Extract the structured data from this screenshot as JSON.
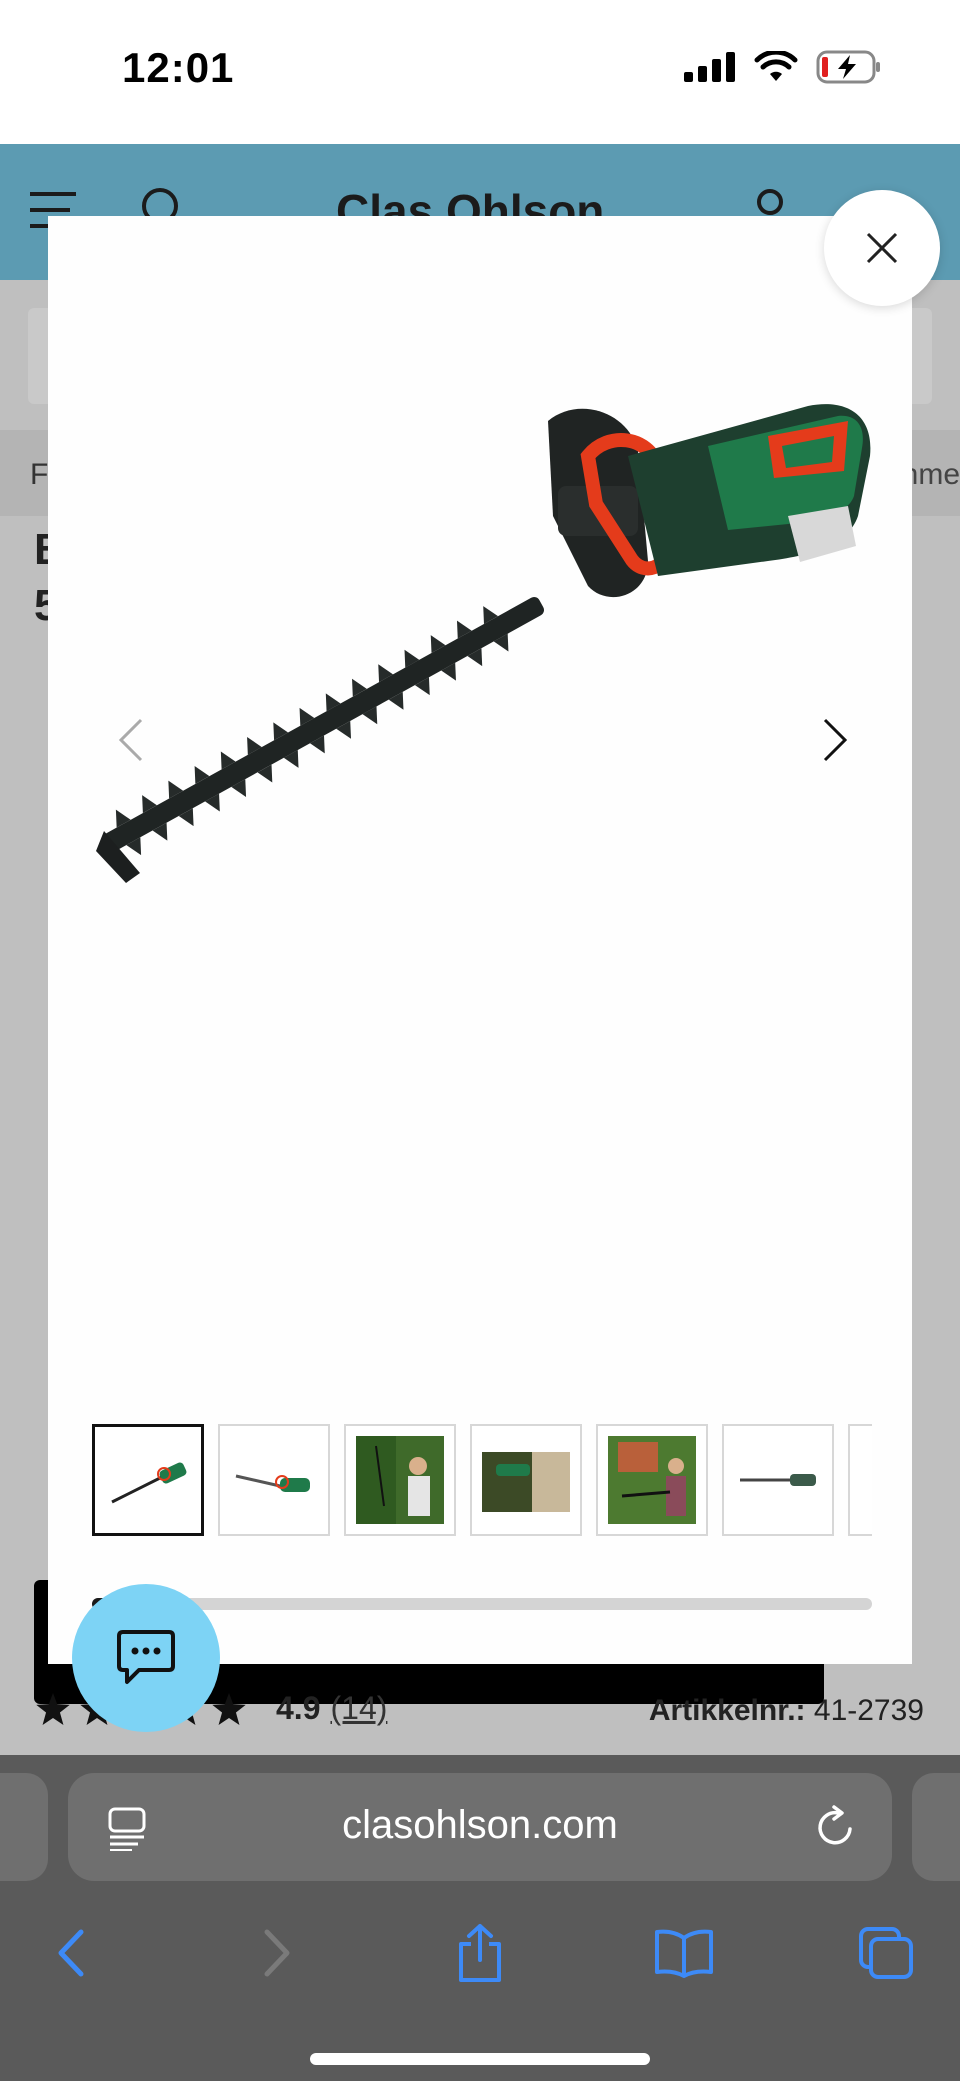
{
  "status_bar": {
    "time": "12:01",
    "icons": [
      "signal-icon",
      "wifi-icon",
      "battery-charging-icon"
    ]
  },
  "site": {
    "logo": "Clas Ohlson",
    "breadcrumb_left": "F",
    "breadcrumb_right": "nme",
    "title_lines": [
      "B",
      "5"
    ],
    "rating": {
      "score": "4.9",
      "count": "(14)"
    },
    "article_number_label": "Artikkelnr.:",
    "article_number": "41-2739"
  },
  "modal": {
    "image_alt": "Hedge trimmer",
    "thumbnails": [
      {
        "name": "thumb-hedge-trimmer-angled",
        "active": true
      },
      {
        "name": "thumb-hedge-trimmer-side",
        "active": false
      },
      {
        "name": "thumb-woman-trimming-hedge",
        "active": false
      },
      {
        "name": "thumb-trimming-closeup",
        "active": false
      },
      {
        "name": "thumb-couple-garden",
        "active": false
      },
      {
        "name": "thumb-hedge-trimmer-flat",
        "active": false
      },
      {
        "name": "thumb-partial",
        "active": false
      }
    ],
    "progress_fraction": 0.11
  },
  "browser": {
    "url": "clasohlson.com"
  },
  "colors": {
    "header_blue": "#5c9bb2",
    "chat_button": "#7dd3f5",
    "safari_blue": "#3d8af7"
  }
}
